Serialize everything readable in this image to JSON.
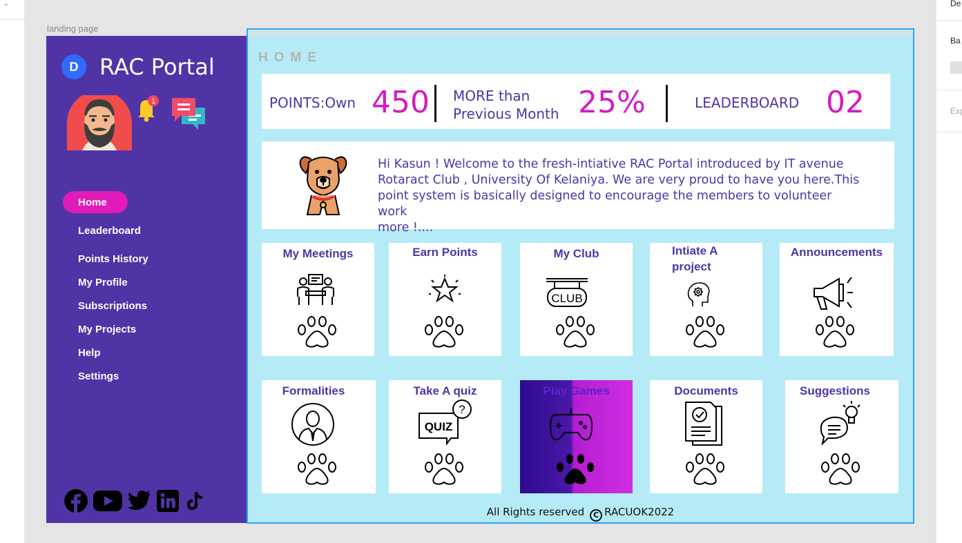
{
  "frame_label": "landing page",
  "right_panel": {
    "de": "De",
    "ba": "Ba",
    "exp": "Exp"
  },
  "brand": {
    "logo_letter": "D",
    "title": "RAC Portal"
  },
  "notifications": {
    "count": "1"
  },
  "nav": {
    "items": [
      {
        "label": "Home",
        "active": true
      },
      {
        "label": "Leaderboard"
      },
      {
        "label": "Points History"
      },
      {
        "label": "My Profile"
      },
      {
        "label": "Subscriptions"
      },
      {
        "label": "My Projects"
      },
      {
        "label": "Help"
      },
      {
        "label": "Settings"
      }
    ]
  },
  "socials": [
    "facebook-icon",
    "youtube-icon",
    "twitter-icon",
    "linkedin-icon",
    "tiktok-icon"
  ],
  "home_label": "HOME",
  "stats": {
    "points_label": "POINTS:Own",
    "points_value": "450",
    "more_label_1": "MORE than",
    "more_label_2": "Previous Month",
    "more_value": "25%",
    "leaderboard_label": "LEADERBOARD",
    "leaderboard_value": "02"
  },
  "welcome": {
    "line1": "Hi Kasun ! Welcome to the fresh-intiative  RAC Portal introduced by IT avenue",
    "line2": "Rotaract Club , University Of Kelaniya. We are very proud to have you here.This",
    "line3": "point system is basically designed to encourage the members to volunteer work",
    "line4": "more !...."
  },
  "cards": [
    {
      "title": "My Meetings",
      "icon": "meeting-icon"
    },
    {
      "title": "Earn Points",
      "icon": "star-icon"
    },
    {
      "title": "My Club",
      "icon": "club-sign-icon"
    },
    {
      "title_1": "Intiate A",
      "title_2": "project",
      "icon": "head-gear-icon"
    },
    {
      "title": "Announcements",
      "icon": "megaphone-icon"
    },
    {
      "title": "Formalities",
      "icon": "person-suit-icon"
    },
    {
      "title": "Take A quiz",
      "icon": "quiz-icon"
    },
    {
      "title": "Play Games",
      "icon": "gamepad-icon"
    },
    {
      "title": "Documents",
      "icon": "document-check-icon"
    },
    {
      "title": "Suggestions",
      "icon": "idea-chat-icon"
    }
  ],
  "footer": {
    "text": "All Rights reserved",
    "copy_symbol": "C",
    "owner": "RACUOK2022"
  },
  "colors": {
    "sidebar": "#5034a6",
    "accent": "#d41bc3",
    "active_nav": "#e01bb7",
    "main_bg": "#b5ebf6",
    "frame_border": "#2aa4f4"
  }
}
